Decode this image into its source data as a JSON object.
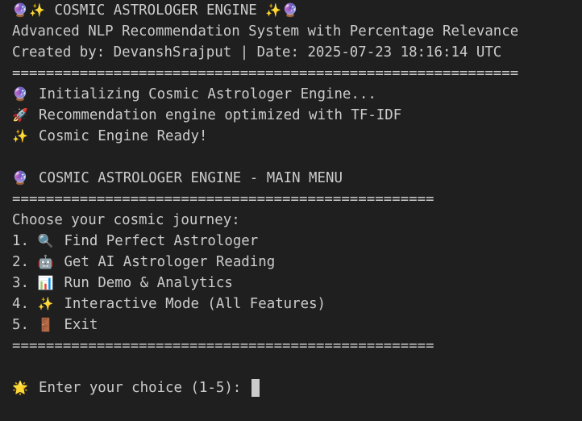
{
  "header": {
    "title": "COSMIC ASTROLOGER ENGINE",
    "subtitle": "Advanced NLP Recommendation System with Percentage Relevance",
    "created_line": "Created by: DevanshSrajput | Date: 2025-07-23 18:16:14 UTC",
    "separator_long": "============================================================"
  },
  "startup": {
    "init": "Initializing Cosmic Astrologer Engine...",
    "optimized": "Recommendation engine optimized with TF-IDF",
    "ready": "Cosmic Engine Ready!"
  },
  "menu": {
    "title": "COSMIC ASTROLOGER ENGINE - MAIN MENU",
    "separator": "==================================================",
    "prompt_heading": "Choose your cosmic journey:",
    "items": [
      {
        "number": "1.",
        "icon": "magnifier-icon",
        "label": "Find Perfect Astrologer"
      },
      {
        "number": "2.",
        "icon": "robot-icon",
        "label": "Get AI Astrologer Reading"
      },
      {
        "number": "3.",
        "icon": "bar-chart-icon",
        "label": "Run Demo & Analytics"
      },
      {
        "number": "4.",
        "icon": "sparkles-icon",
        "label": "Interactive Mode (All Features)"
      },
      {
        "number": "5.",
        "icon": "door-icon",
        "label": "Exit"
      }
    ]
  },
  "input": {
    "prompt": "Enter your choice (1-5):",
    "value": ""
  },
  "colors": {
    "background": "#1f1f1f",
    "text": "#cccccc",
    "cursor": "#cccccc"
  }
}
